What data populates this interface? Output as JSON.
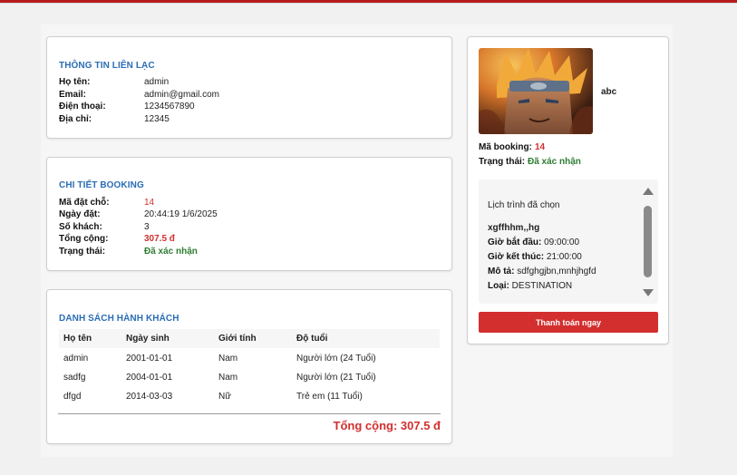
{
  "contact": {
    "title": "THÔNG TIN LIÊN LẠC",
    "rows": [
      {
        "label": "Họ tên:",
        "value": "admin"
      },
      {
        "label": "Email:",
        "value": "admin@gmail.com"
      },
      {
        "label": "Điện thoại:",
        "value": "1234567890"
      },
      {
        "label": "Địa chỉ:",
        "value": "12345"
      }
    ]
  },
  "booking": {
    "title": "CHI TIẾT BOOKING",
    "rows": [
      {
        "label": "Mã đặt chỗ:",
        "value": "14"
      },
      {
        "label": "Ngày đặt:",
        "value": "20:44:19 1/6/2025"
      },
      {
        "label": "Số khách:",
        "value": "3"
      },
      {
        "label": "Tổng cộng:",
        "value": "307.5 đ"
      },
      {
        "label": "Trạng thái:",
        "value": "Đã xác nhận"
      }
    ]
  },
  "passengers": {
    "title": "DANH SÁCH HÀNH KHÁCH",
    "columns": [
      "Họ tên",
      "Ngày sinh",
      "Giới tính",
      "Độ tuổi"
    ],
    "rows": [
      [
        "admin",
        "2001-01-01",
        "Nam",
        "Người lớn (24 Tuổi)"
      ],
      [
        "sadfg",
        "2004-01-01",
        "Nam",
        "Người lớn (21 Tuổi)"
      ],
      [
        "dfgd",
        "2014-03-03",
        "Nữ",
        "Trẻ em (11 Tuổi)"
      ]
    ],
    "total": "Tổng cộng: 307.5 đ"
  },
  "summary": {
    "username": "abc",
    "booking_label": "Mã booking:",
    "booking_value": "14",
    "status_label": "Trạng thái:",
    "status_value": "Đã xác nhận",
    "schedule": {
      "heading": "Lịch trình đã chọn",
      "name": "xgffhhm,,hg",
      "start_label": "Giờ bắt đầu:",
      "start_value": "09:00:00",
      "end_label": "Giờ kết thúc:",
      "end_value": "21:00:00",
      "desc_label": "Mô tả:",
      "desc_value": "sdfghgjbn,mnhjhgfd",
      "type_label": "Loại:",
      "type_value": "DESTINATION"
    },
    "pay_button": "Thanh toán ngay"
  },
  "colors": {
    "accent_blue": "#2a6db5",
    "accent_red": "#d32f2f",
    "status_green": "#2e7d32"
  }
}
